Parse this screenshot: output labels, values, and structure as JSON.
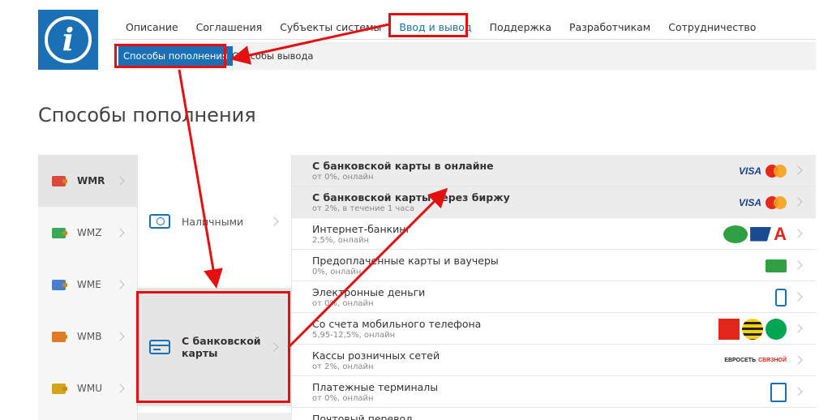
{
  "logo": {
    "letter": "i"
  },
  "topnav": [
    {
      "label": "Описание",
      "active": false
    },
    {
      "label": "Соглашения",
      "active": false
    },
    {
      "label": "Субъекты системы",
      "active": false
    },
    {
      "label": "Ввод и вывод",
      "active": true
    },
    {
      "label": "Поддержка",
      "active": false
    },
    {
      "label": "Разработчикам",
      "active": false
    },
    {
      "label": "Сотрудничество",
      "active": false
    }
  ],
  "subnav": {
    "active": "Способы пополнения",
    "other": "Способы вывода"
  },
  "page_title": "Способы пополнения",
  "currencies": [
    {
      "label": "WMR",
      "active": true,
      "color": "#d94a3b"
    },
    {
      "label": "WMZ",
      "active": false,
      "color": "#3aa857"
    },
    {
      "label": "WME",
      "active": false,
      "color": "#4a7ec9"
    },
    {
      "label": "WMB",
      "active": false,
      "color": "#e07b2a"
    },
    {
      "label": "WMU",
      "active": false,
      "color": "#d4a41c"
    }
  ],
  "methods": [
    {
      "label": "Наличными",
      "active": false,
      "icon": "cash-icon"
    },
    {
      "label": "С банковской карты",
      "active": true,
      "icon": "bank-card-icon"
    }
  ],
  "options": [
    {
      "title": "С банковской карты в онлайне",
      "sub": "от 0%, онлайн",
      "logos": "visa-mastercard"
    },
    {
      "title": "С банковской карты через биржу",
      "sub": "от 2%, в течение 1 часа",
      "logos": "visa-mastercard"
    },
    {
      "title": "Интернет-банкинг",
      "sub": "2,5%, онлайн",
      "logos": "banks"
    },
    {
      "title": "Предоплаченные карты и ваучеры",
      "sub": "0%, онлайн",
      "logos": "voucher"
    },
    {
      "title": "Электронные деньги",
      "sub": "от 0%, онлайн",
      "logos": "phone"
    },
    {
      "title": "Со счета мобильного телефона",
      "sub": "5,95-12,5%, онлайн",
      "logos": "mobile"
    },
    {
      "title": "Кассы розничных сетей",
      "sub": "от 2%, онлайн",
      "logos": "retail"
    },
    {
      "title": "Платежные терминалы",
      "sub": "от 0%, онлайн",
      "logos": "atm"
    },
    {
      "title": "Почтовый перевод",
      "sub": "",
      "logos": "post"
    }
  ],
  "logo_text": {
    "visa": "VISA",
    "alfa": "А",
    "shop1": "ЕВРОСЕТЬ",
    "shop2": "СВЯЗНОЙ"
  },
  "colors": {
    "accent": "#1a6fb5",
    "highlight": "#e3100f"
  }
}
